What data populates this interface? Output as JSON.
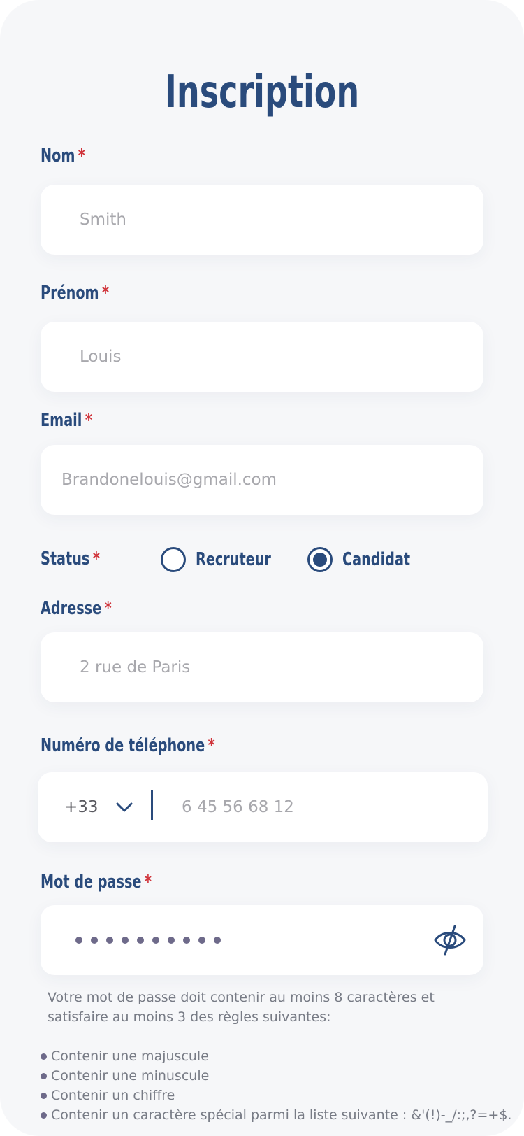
{
  "form": {
    "title": "Inscription",
    "required_marker": "*",
    "fields": {
      "nom": {
        "label": "Nom",
        "value": "Smith"
      },
      "prenom": {
        "label": "Prénom",
        "value": "Louis"
      },
      "email": {
        "label": "Email",
        "value": "Brandonelouis@gmail.com"
      },
      "adresse": {
        "label": "Adresse",
        "value": "2 rue de Paris"
      },
      "telephone": {
        "label": "Numéro de téléphone",
        "country_code": "+33",
        "value": "6 45 56 68 12"
      },
      "password": {
        "label": "Mot de passe",
        "masked_length": 10
      }
    },
    "status": {
      "label": "Status",
      "options": [
        {
          "label": "Recruteur",
          "checked": false
        },
        {
          "label": "Candidat",
          "checked": true
        }
      ]
    },
    "password_hint": "Votre mot de passe doit contenir au moins 8 caractères et satisfaire au moins  3 des règles suivantes:",
    "password_rules": [
      "Contenir une majuscule",
      "Contenir une minuscule",
      "Contenir un chiffre",
      "Contenir un caractère spécial parmi la liste suivante : &'(!)-_/:;,?=+$."
    ]
  },
  "icons": {
    "country_dropdown": "chevron-down-icon",
    "password_visibility": "eye-off-icon",
    "radio": "radio-button-icon"
  },
  "colors": {
    "primary": "#2a4b7c",
    "required": "#d0343b",
    "background": "#f6f7f9",
    "field": "#ffffff",
    "placeholder_text": "#a8a8ad",
    "hint_text": "#777b85"
  }
}
